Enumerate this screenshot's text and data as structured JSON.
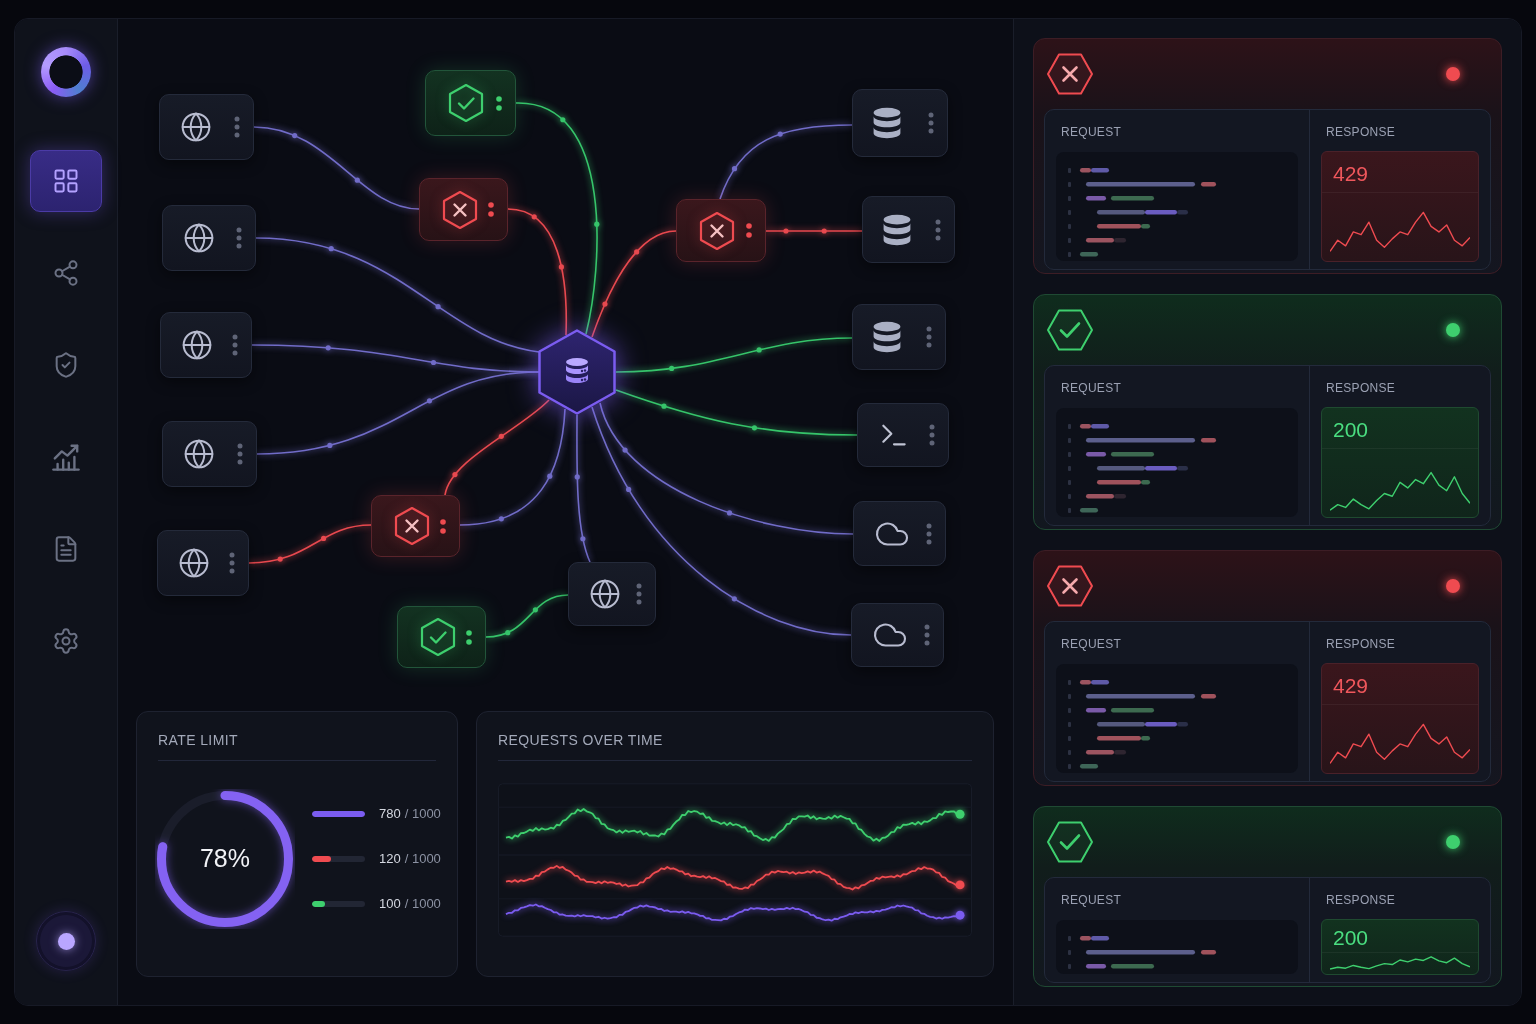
{
  "sidebar": {
    "items": [
      {
        "kind": "dashboard",
        "selected": true
      },
      {
        "kind": "share",
        "selected": false
      },
      {
        "kind": "shield",
        "selected": false
      },
      {
        "kind": "analytics",
        "selected": false
      },
      {
        "kind": "document",
        "selected": false
      },
      {
        "kind": "settings",
        "selected": false
      }
    ]
  },
  "diagram": {
    "nodes": [
      {
        "kind": "globe"
      },
      {
        "kind": "globe"
      },
      {
        "kind": "globe"
      },
      {
        "kind": "globe"
      },
      {
        "kind": "globe"
      },
      {
        "kind": "allowed"
      },
      {
        "kind": "blocked"
      },
      {
        "kind": "blocked"
      },
      {
        "kind": "allowed"
      },
      {
        "kind": "globe"
      },
      {
        "kind": "hub"
      },
      {
        "kind": "blocked"
      },
      {
        "kind": "database"
      },
      {
        "kind": "database"
      },
      {
        "kind": "database"
      },
      {
        "kind": "terminal"
      },
      {
        "kind": "cloud"
      },
      {
        "kind": "cloud"
      }
    ],
    "edges": [
      {
        "color": "#716cc8"
      },
      {
        "color": "#e8494f"
      },
      {
        "color": "#36c46a"
      },
      {
        "color": "#716cc8"
      },
      {
        "color": "#716cc8"
      },
      {
        "color": "#716cc8"
      },
      {
        "color": "#e8494f"
      },
      {
        "color": "#e8494f"
      },
      {
        "color": "#716cc8"
      },
      {
        "color": "#716cc8"
      },
      {
        "color": "#36c46a"
      },
      {
        "color": "#e8494f"
      },
      {
        "color": "#716cc8"
      },
      {
        "color": "#e8494f"
      },
      {
        "color": "#36c46a"
      },
      {
        "color": "#36c46a"
      },
      {
        "color": "#716cc8"
      },
      {
        "color": "#716cc8"
      }
    ]
  },
  "rate_limit": {
    "title": "RATE LIMIT",
    "gauge": {
      "label": "78%",
      "level": 0.78
    },
    "rows": [
      {
        "value": "780",
        "total": "/ 1000",
        "color": "#7b5cf0",
        "level": 1
      },
      {
        "value": "120",
        "total": "/ 1000",
        "color": "#ef4b50",
        "level": 0.35
      },
      {
        "value": "100",
        "total": "/ 1000",
        "color": "#3ecf6e",
        "level": 0.24
      }
    ]
  },
  "requests_over_time": {
    "title": "REQUESTS OVER TIME",
    "lines": [
      {
        "color": "#3ecf6e"
      },
      {
        "color": "#ef4b50"
      },
      {
        "color": "#7b5cf0"
      }
    ]
  },
  "traffic_log": [
    {
      "kind": "blocked",
      "request_label": "REQUEST",
      "response_label": "RESPONSE",
      "code": "429"
    },
    {
      "kind": "allowed",
      "request_label": "REQUEST",
      "response_label": "RESPONSE",
      "code": "200"
    },
    {
      "kind": "blocked",
      "request_label": "REQUEST",
      "response_label": "RESPONSE",
      "code": "429"
    },
    {
      "kind": "allowed",
      "request_label": "REQUEST",
      "response_label": "RESPONSE",
      "code": "200"
    }
  ]
}
